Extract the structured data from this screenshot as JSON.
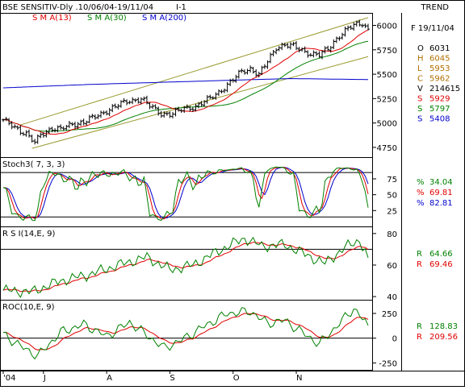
{
  "header": {
    "title": "BSE SENSITIV-Dly .10/06/04-19/11/04",
    "interval": "I-1",
    "trend_label": "TREND"
  },
  "colors": {
    "price": "#000000",
    "sma13": "#e00000",
    "sma30": "#008000",
    "sma200": "#0000cc",
    "channel": "#9a9a30",
    "stoch_k": "#008000",
    "stoch_d1": "#e00000",
    "stoch_d2": "#0000cc",
    "ind_main": "#008000",
    "ind_signal": "#e00000"
  },
  "quote": {
    "date": "F 19/11/04",
    "rows": [
      {
        "label": "O",
        "value": "6031",
        "color": "#000000"
      },
      {
        "label": "H",
        "value": "6045",
        "color": "#b07000"
      },
      {
        "label": "L",
        "value": "5953",
        "color": "#b07000"
      },
      {
        "label": "C",
        "value": "5962",
        "color": "#b07000"
      },
      {
        "label": "V",
        "value": "214615",
        "color": "#000000"
      },
      {
        "label": "S",
        "value": "5929",
        "color": "#e00000"
      },
      {
        "label": "S",
        "value": "5797",
        "color": "#008000"
      },
      {
        "label": "S",
        "value": "5408",
        "color": "#0000cc"
      }
    ]
  },
  "chart_data": [
    {
      "type": "ohlc",
      "panel": "price",
      "legend": [
        {
          "name": "S M A(13)",
          "color": "#e00000"
        },
        {
          "name": "S M A(30)",
          "color": "#008000"
        },
        {
          "name": "S M A(200)",
          "color": "#0000cc"
        }
      ],
      "y_ticks": [
        6000,
        5750,
        5500,
        5250,
        5000,
        4750
      ],
      "ylim": [
        4650,
        6120
      ],
      "x_tick_labels": [
        "'04",
        "J",
        "A",
        "S",
        "O",
        "N"
      ],
      "close_anchors": [
        {
          "i": 0,
          "v": 5020
        },
        {
          "i": 4,
          "v": 4960
        },
        {
          "i": 8,
          "v": 4890
        },
        {
          "i": 11,
          "v": 4790
        },
        {
          "i": 13,
          "v": 4880
        },
        {
          "i": 17,
          "v": 4950
        },
        {
          "i": 20,
          "v": 4930
        },
        {
          "i": 24,
          "v": 4990
        },
        {
          "i": 28,
          "v": 5010
        },
        {
          "i": 32,
          "v": 5060
        },
        {
          "i": 36,
          "v": 5130
        },
        {
          "i": 40,
          "v": 5180
        },
        {
          "i": 44,
          "v": 5230
        },
        {
          "i": 48,
          "v": 5250
        },
        {
          "i": 51,
          "v": 5170
        },
        {
          "i": 55,
          "v": 5100
        },
        {
          "i": 59,
          "v": 5090
        },
        {
          "i": 63,
          "v": 5150
        },
        {
          "i": 67,
          "v": 5170
        },
        {
          "i": 71,
          "v": 5230
        },
        {
          "i": 75,
          "v": 5320
        },
        {
          "i": 79,
          "v": 5410
        },
        {
          "i": 83,
          "v": 5530
        },
        {
          "i": 86,
          "v": 5560
        },
        {
          "i": 89,
          "v": 5490
        },
        {
          "i": 92,
          "v": 5630
        },
        {
          "i": 95,
          "v": 5780
        },
        {
          "i": 98,
          "v": 5800
        },
        {
          "i": 101,
          "v": 5780
        },
        {
          "i": 104,
          "v": 5750
        },
        {
          "i": 107,
          "v": 5710
        },
        {
          "i": 110,
          "v": 5690
        },
        {
          "i": 113,
          "v": 5760
        },
        {
          "i": 116,
          "v": 5870
        },
        {
          "i": 119,
          "v": 5940
        },
        {
          "i": 122,
          "v": 6000
        },
        {
          "i": 125,
          "v": 6030
        },
        {
          "i": 127,
          "v": 5962
        }
      ],
      "sma200_anchors": [
        {
          "i": 0,
          "v": 5360
        },
        {
          "i": 30,
          "v": 5395
        },
        {
          "i": 70,
          "v": 5430
        },
        {
          "i": 100,
          "v": 5455
        },
        {
          "i": 127,
          "v": 5445
        }
      ],
      "channel_lines": [
        {
          "i0": 10,
          "v0": 4740,
          "i1": 127,
          "v1": 5680
        },
        {
          "i0": 6,
          "v0": 4980,
          "i1": 127,
          "v1": 6080
        }
      ]
    },
    {
      "type": "line",
      "panel": "stochastic",
      "title": "Stoch3( 7, 3, 3)",
      "y_ticks": [
        75,
        50,
        25
      ],
      "ylim": [
        0,
        108
      ],
      "ref_lines": [
        85,
        15
      ],
      "series": [
        {
          "name": "%",
          "value": "34.04",
          "color": "#008000"
        },
        {
          "name": "%",
          "value": "69.81",
          "color": "#e00000"
        },
        {
          "name": "%",
          "value": "82.81",
          "color": "#0000cc"
        }
      ]
    },
    {
      "type": "line",
      "panel": "rsi",
      "title": "R S I(14,E, 9)",
      "y_ticks": [
        80,
        60,
        40
      ],
      "ylim": [
        38,
        84
      ],
      "ref_lines": [
        70
      ],
      "anchors": [
        {
          "i": 0,
          "v": 44
        },
        {
          "i": 10,
          "v": 43
        },
        {
          "i": 20,
          "v": 50
        },
        {
          "i": 30,
          "v": 54
        },
        {
          "i": 40,
          "v": 60
        },
        {
          "i": 50,
          "v": 65
        },
        {
          "i": 58,
          "v": 57
        },
        {
          "i": 66,
          "v": 60
        },
        {
          "i": 76,
          "v": 70
        },
        {
          "i": 84,
          "v": 77
        },
        {
          "i": 90,
          "v": 72
        },
        {
          "i": 98,
          "v": 73
        },
        {
          "i": 106,
          "v": 66
        },
        {
          "i": 112,
          "v": 61
        },
        {
          "i": 118,
          "v": 70
        },
        {
          "i": 124,
          "v": 76
        },
        {
          "i": 127,
          "v": 64.66
        }
      ],
      "series": [
        {
          "name": "R",
          "value": "64.66",
          "color": "#008000"
        },
        {
          "name": "R",
          "value": "69.46",
          "color": "#e00000"
        }
      ]
    },
    {
      "type": "line",
      "panel": "roc",
      "title": "ROC(10,E, 9)",
      "y_ticks": [
        250,
        0,
        -250
      ],
      "ylim": [
        -320,
        380
      ],
      "ref_lines": [
        0
      ],
      "anchors": [
        {
          "i": 0,
          "v": 40
        },
        {
          "i": 6,
          "v": -80
        },
        {
          "i": 12,
          "v": -180
        },
        {
          "i": 20,
          "v": 60
        },
        {
          "i": 28,
          "v": 140
        },
        {
          "i": 36,
          "v": 20
        },
        {
          "i": 44,
          "v": 160
        },
        {
          "i": 50,
          "v": 30
        },
        {
          "i": 56,
          "v": -100
        },
        {
          "i": 62,
          "v": -20
        },
        {
          "i": 70,
          "v": 120
        },
        {
          "i": 78,
          "v": 250
        },
        {
          "i": 86,
          "v": 270
        },
        {
          "i": 92,
          "v": 150
        },
        {
          "i": 98,
          "v": 180
        },
        {
          "i": 104,
          "v": 60
        },
        {
          "i": 110,
          "v": -60
        },
        {
          "i": 116,
          "v": 120
        },
        {
          "i": 122,
          "v": 300
        },
        {
          "i": 127,
          "v": 128.83
        }
      ],
      "series": [
        {
          "name": "R",
          "value": "128.83",
          "color": "#008000"
        },
        {
          "name": "R",
          "value": "209.56",
          "color": "#e00000"
        }
      ]
    }
  ]
}
